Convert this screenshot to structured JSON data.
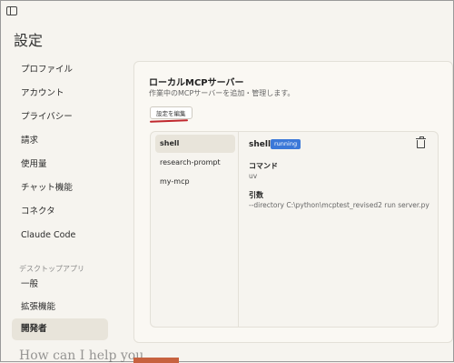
{
  "window": {
    "title": "設定"
  },
  "sidebar": {
    "items": [
      {
        "label": "プロファイル"
      },
      {
        "label": "アカウント"
      },
      {
        "label": "プライバシー"
      },
      {
        "label": "請求"
      },
      {
        "label": "使用量"
      },
      {
        "label": "チャット機能"
      },
      {
        "label": "コネクタ"
      },
      {
        "label": "Claude Code"
      }
    ],
    "section_label": "デスクトップアプリ",
    "desktop_items": [
      {
        "label": "一般"
      },
      {
        "label": "拡張機能"
      },
      {
        "label": "開発者",
        "active": true
      }
    ]
  },
  "panel": {
    "title": "ローカルMCPサーバー",
    "subtitle": "作業中のMCPサーバーを追加・管理します。",
    "edit_button": "設定を編集",
    "servers": [
      {
        "name": "shell",
        "active": true
      },
      {
        "name": "research-prompt"
      },
      {
        "name": "my-mcp"
      }
    ],
    "detail": {
      "name": "shell",
      "status": "running",
      "status_color": "#3b78d8",
      "command_label": "コマンド",
      "command_value": "uv",
      "args_label": "引数",
      "args_value": "--directory C:\\python\\mcptest_revised2 run server.py"
    }
  },
  "background": {
    "text": "How can I help you"
  },
  "colors": {
    "underline": "#c0272d",
    "accent": "#c7623f"
  }
}
